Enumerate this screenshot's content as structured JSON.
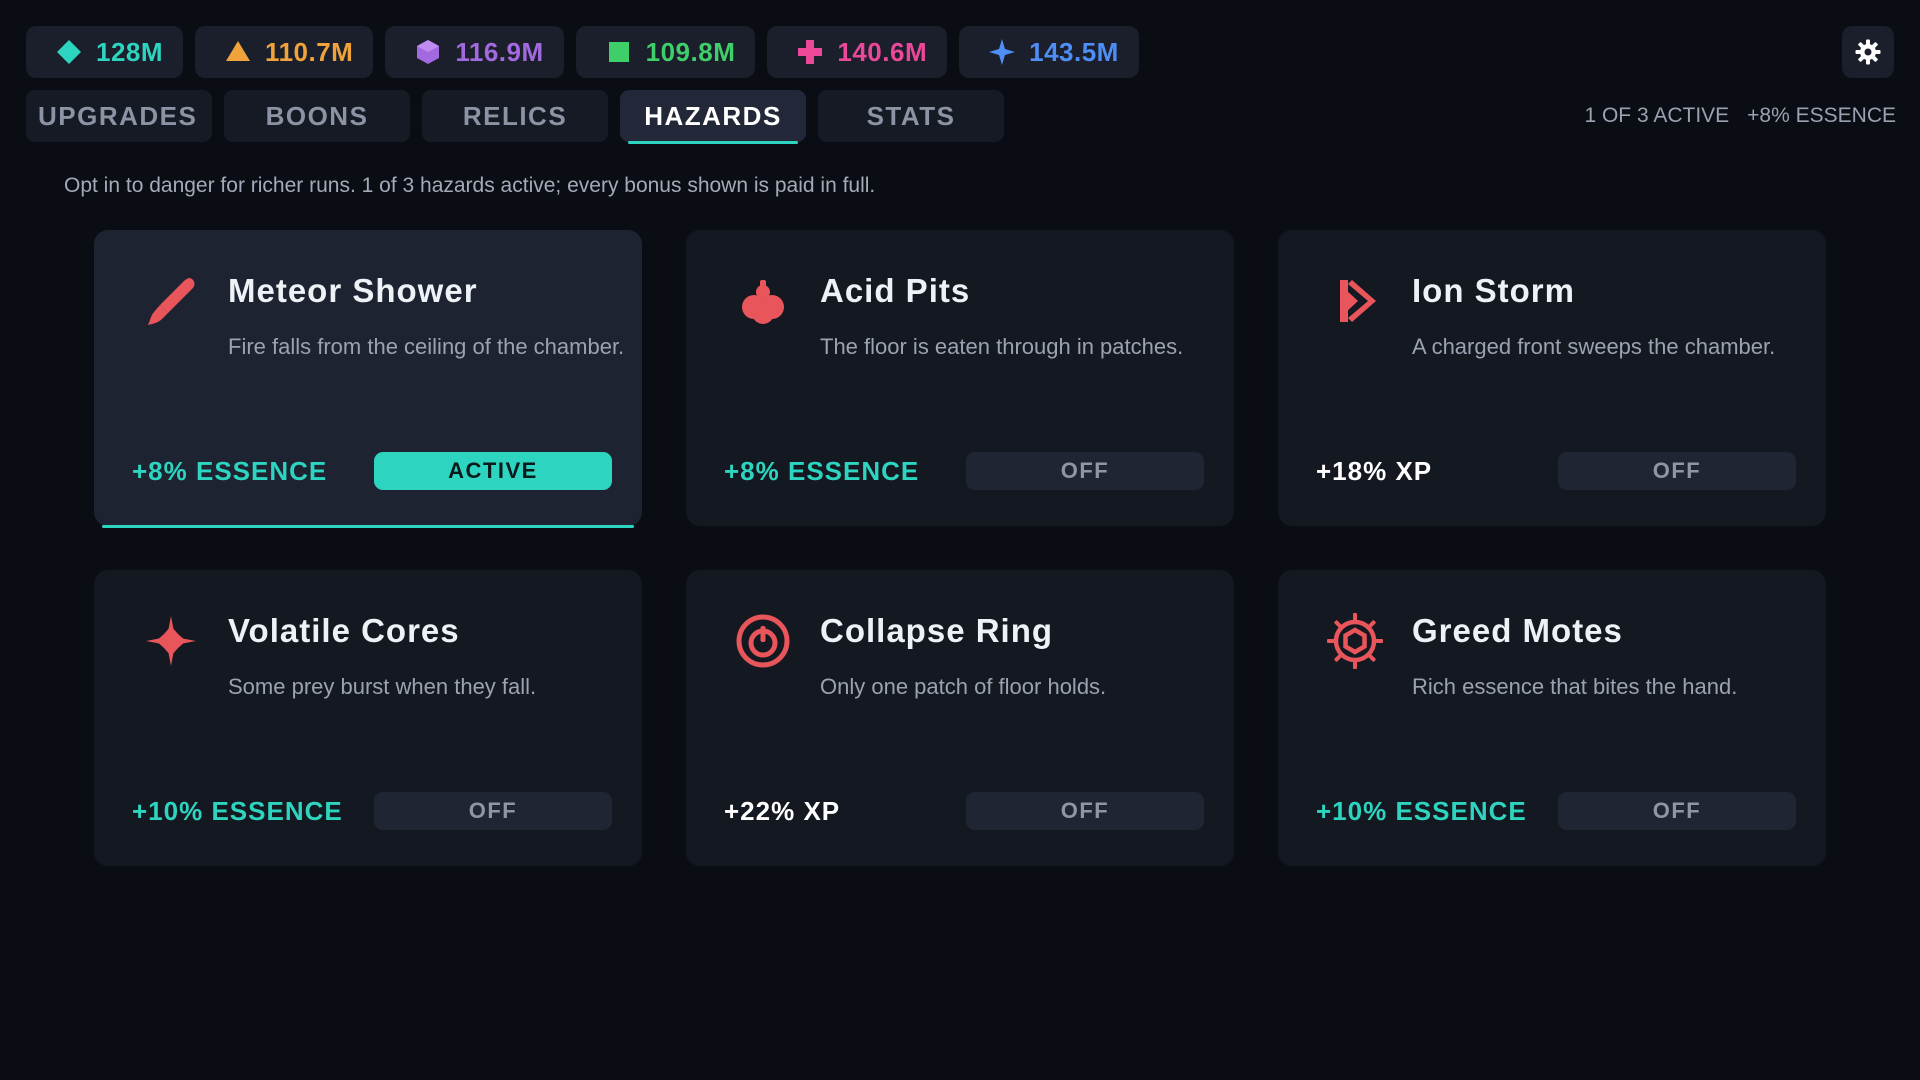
{
  "resources": [
    {
      "value": "128M",
      "color": "#2dd4bf",
      "icon": "diamond-icon"
    },
    {
      "value": "110.7M",
      "color": "#f0a33a",
      "icon": "triangle-icon"
    },
    {
      "value": "116.9M",
      "color": "#a36ae0",
      "icon": "hexagon-icon"
    },
    {
      "value": "109.8M",
      "color": "#3fcf6a",
      "icon": "square-icon"
    },
    {
      "value": "140.6M",
      "color": "#ec4899",
      "icon": "plus-icon"
    },
    {
      "value": "143.5M",
      "color": "#4f8ef7",
      "icon": "star4-icon"
    }
  ],
  "tabs": [
    {
      "label": "UPGRADES"
    },
    {
      "label": "BOONS"
    },
    {
      "label": "RELICS"
    },
    {
      "label": "HAZARDS",
      "active": true
    },
    {
      "label": "STATS"
    }
  ],
  "summary": {
    "active_count": "1 OF 3 ACTIVE",
    "bonus": "+8% ESSENCE"
  },
  "intro": "Opt in to danger for richer runs. 1 of 3 hazards active; every bonus shown is paid in full.",
  "hazards": [
    {
      "title": "Meteor Shower",
      "desc": "Fire falls from the ceiling of the chamber.",
      "bonus": "+8% ESSENCE",
      "toggle": "ACTIVE",
      "icon": "meteor-icon"
    },
    {
      "title": "Acid Pits",
      "desc": "The floor is eaten through in patches.",
      "bonus": "+8% ESSENCE",
      "toggle": "OFF",
      "icon": "acid-drop-icon"
    },
    {
      "title": "Ion Storm",
      "desc": "A charged front sweeps the chamber.",
      "bonus": "+18% XP",
      "toggle": "OFF",
      "icon": "lightning-icon"
    },
    {
      "title": "Volatile Cores",
      "desc": "Some prey burst when they fall.",
      "bonus": "+10% ESSENCE",
      "toggle": "OFF",
      "icon": "burst-star-icon"
    },
    {
      "title": "Collapse Ring",
      "desc": "Only one patch of floor holds.",
      "bonus": "+22% XP",
      "toggle": "OFF",
      "icon": "collapse-ring-icon"
    },
    {
      "title": "Greed Motes",
      "desc": "Rich essence that bites the hand.",
      "bonus": "+10% ESSENCE",
      "toggle": "OFF",
      "icon": "gear-gem-icon"
    }
  ],
  "colors": {
    "accent": "#2dd4bf",
    "hazard": "#e8555a"
  }
}
